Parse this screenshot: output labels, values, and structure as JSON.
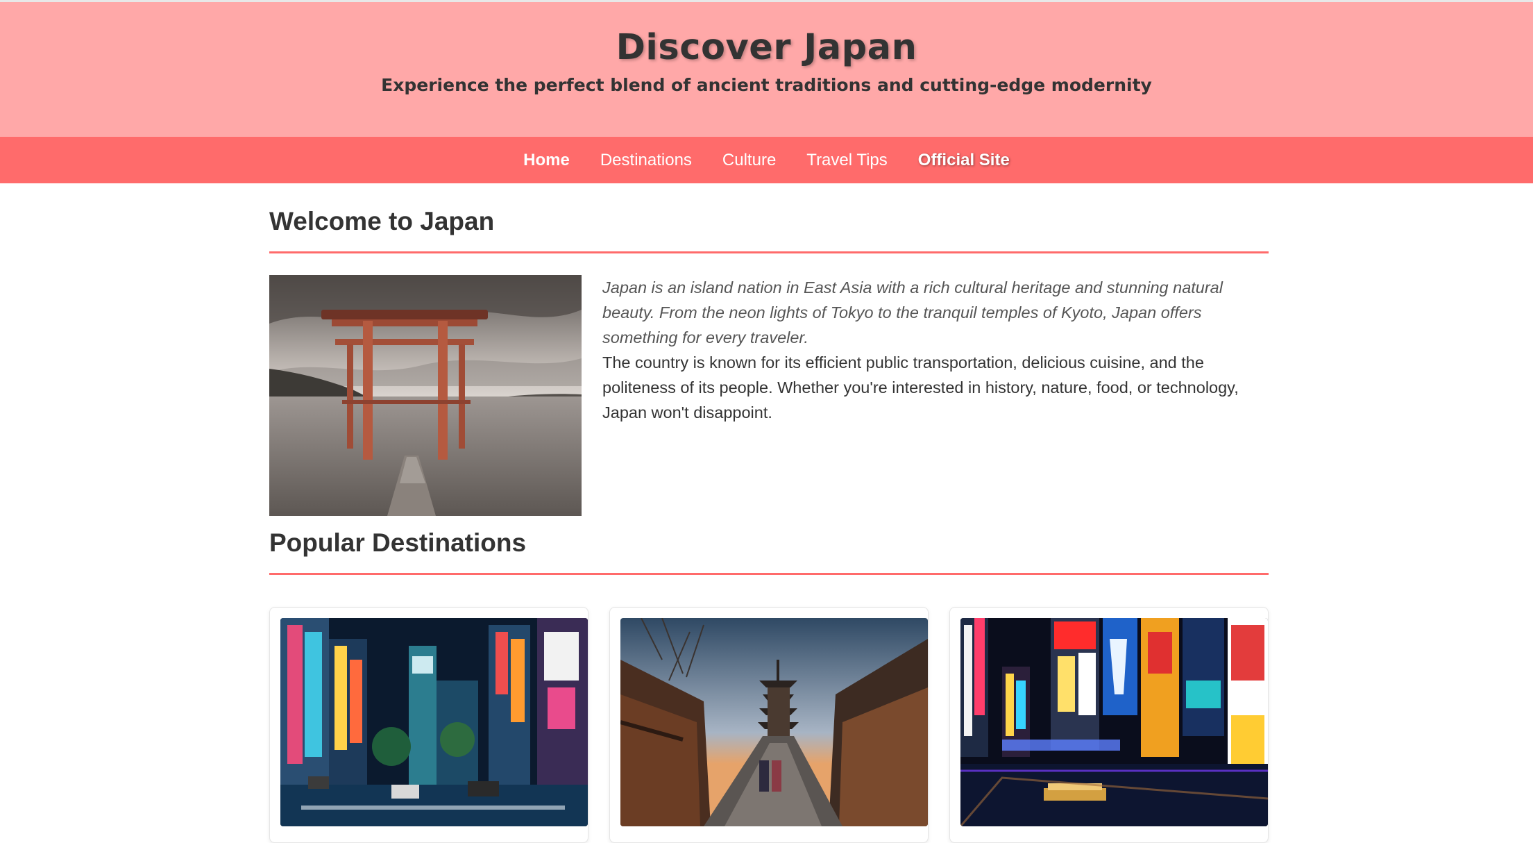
{
  "header": {
    "title": "Discover Japan",
    "subtitle": "Experience the perfect blend of ancient traditions and cutting-edge modernity"
  },
  "nav": {
    "items": [
      {
        "label": "Home"
      },
      {
        "label": "Destinations"
      },
      {
        "label": "Culture"
      },
      {
        "label": "Travel Tips"
      },
      {
        "label": "Official Site"
      }
    ]
  },
  "welcome": {
    "title": "Welcome to Japan",
    "lead": "Japan is an island nation in East Asia with a rich cultural heritage and stunning natural beauty. From the neon lights of Tokyo to the tranquil temples of Kyoto, Japan offers something for every traveler.",
    "body": "The country is known for its efficient public transportation, delicious cuisine, and the politeness of its people. Whether you're interested in history, nature, food, or technology, Japan won't disappoint."
  },
  "destinations": {
    "title": "Popular Destinations"
  },
  "colors": {
    "header_bg": "#ffa8a8",
    "nav_bg": "#ff6b6b",
    "accent": "#ff6b6b",
    "text": "#333333"
  }
}
